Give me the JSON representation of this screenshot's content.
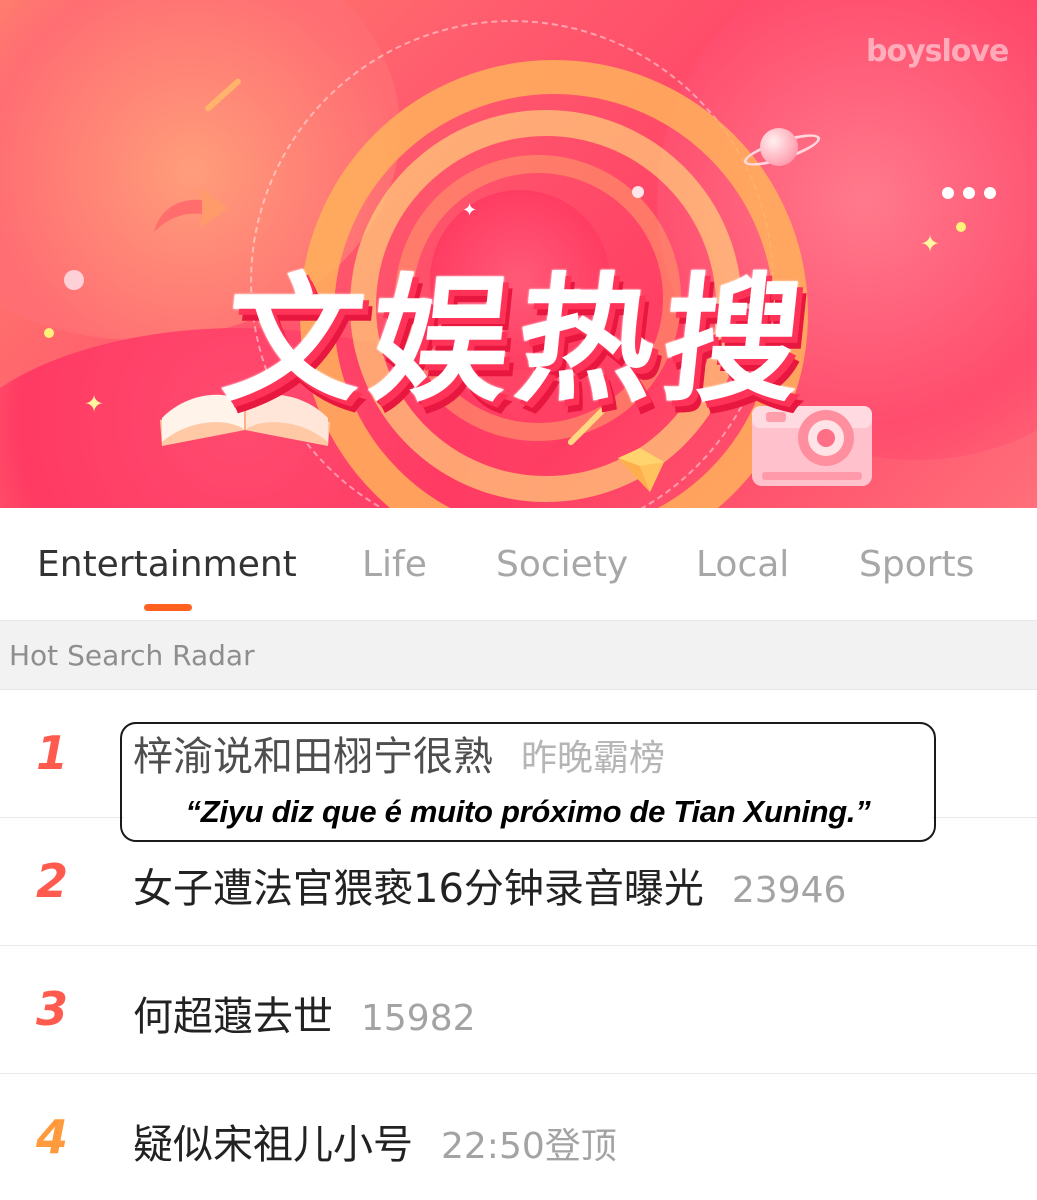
{
  "banner": {
    "title": "文娱热搜",
    "watermark": "boyslove"
  },
  "tabs": [
    {
      "label": "Entertainment",
      "active": true
    },
    {
      "label": "Life",
      "active": false
    },
    {
      "label": "Society",
      "active": false
    },
    {
      "label": "Local",
      "active": false
    },
    {
      "label": "Sports",
      "active": false
    }
  ],
  "section": {
    "title": "Hot Search Radar"
  },
  "list": [
    {
      "rank": "1",
      "query": "梓渝说和田栩宁很熟",
      "meta": "昨晚霸榜"
    },
    {
      "rank": "2",
      "query": "女子遭法官猥亵16分钟录音曝光",
      "meta": "23946"
    },
    {
      "rank": "3",
      "query": "何超蕸去世",
      "meta": "15982"
    },
    {
      "rank": "4",
      "query": "疑似宋祖儿小号",
      "meta": "22:50登顶"
    }
  ],
  "caption": {
    "text": "“Ziyu diz que é muito próximo de Tian Xuning.”"
  },
  "colors": {
    "accent": "#ff6020",
    "rank_top": "#ff5a4e",
    "rank_mid": "#ff9b3d",
    "banner": "#ff3d63"
  }
}
